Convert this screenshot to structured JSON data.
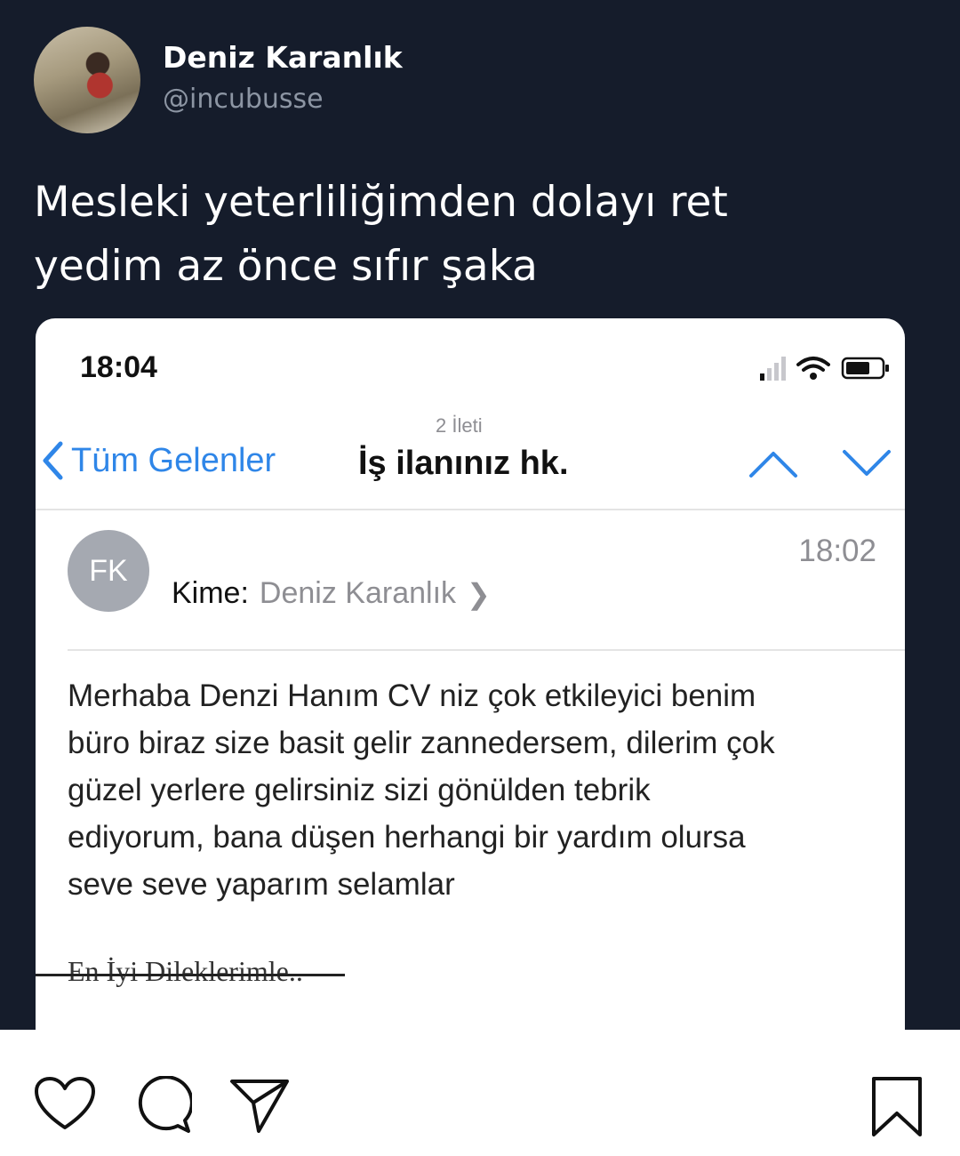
{
  "tweet": {
    "author_name": "Deniz Karanlık",
    "author_handle": "@incubusse",
    "text_line1": "Mesleki yeterliliğimden dolayı ret",
    "text_line2": "yedim az önce sıfır şaka"
  },
  "phone": {
    "status_time": "18:04"
  },
  "mail_nav": {
    "thread_count": "2 İleti",
    "back_label": "Tüm Gelenler",
    "subject": "İş ilanınız hk."
  },
  "mail": {
    "sender_initials": "FK",
    "time": "18:02",
    "to_label": "Kime:",
    "to_name": "Deniz Karanlık",
    "body_lines": [
      "Merhaba Denzi Hanım CV niz çok etkileyici benim",
      "büro biraz size basit gelir zannedersem, dilerim çok",
      "güzel yerlere gelirsiniz sizi gönülden tebrik",
      "ediyorum, bana düşen herhangi bir yardım olursa",
      "seve seve yaparım selamlar"
    ],
    "signature": "En İyi Dileklerimle.."
  },
  "actions": {
    "icons": [
      "heart-icon",
      "comment-icon",
      "share-icon",
      "bookmark-icon"
    ]
  },
  "colors": {
    "post_bg": "#151c2b",
    "ios_blue": "#2f86e8",
    "gray_text": "#8e8e93"
  }
}
